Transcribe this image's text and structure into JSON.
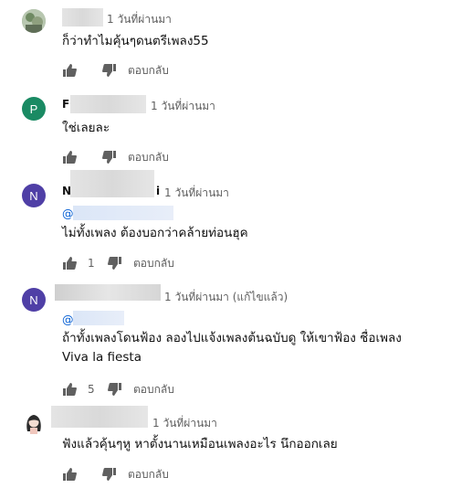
{
  "comments": [
    {
      "avatar_letter": "",
      "avatar_kind": "photo",
      "visible_name_fragment": "",
      "time": "1 วันที่ผ่านมา",
      "mention": "",
      "text_lines": [
        "ก็ว่าทำไมคุ้นๆดนตรีเพลง55"
      ],
      "likes": "",
      "reply_label": "ตอบกลับ"
    },
    {
      "avatar_letter": "P",
      "avatar_color": "#1a8a63",
      "visible_name_fragment": "F",
      "time": "1 วันที่ผ่านมา",
      "mention": "",
      "text_lines": [
        "ใช่เลยละ"
      ],
      "likes": "",
      "reply_label": "ตอบกลับ"
    },
    {
      "avatar_letter": "N",
      "avatar_color": "#4f3fa6",
      "visible_name_fragment": "N",
      "visible_name_tail": "i",
      "time": "1 วันที่ผ่านมา",
      "mention": "@",
      "text_lines": [
        "ไม่ทั้งเพลง ต้องบอกว่าคล้ายท่อนฮุค"
      ],
      "likes": "1",
      "reply_label": "ตอบกลับ"
    },
    {
      "avatar_letter": "N",
      "avatar_color": "#4f3fa6",
      "visible_name_fragment": "",
      "time": "1 วันที่ผ่านมา (แก้ไขแล้ว)",
      "mention": "@",
      "text_lines": [
        "ถ้าทั้งเพลงโดนฟ้อง   ลองไปแจ้งเพลงต้นฉบับดู ให้เขาฟ้อง ชื่อเพลง",
        "Viva la fiesta"
      ],
      "likes": "5",
      "reply_label": "ตอบกลับ"
    },
    {
      "avatar_letter": "",
      "avatar_kind": "drawing",
      "visible_name_fragment": "",
      "time": "1 วันที่ผ่านมา",
      "mention": "",
      "text_lines": [
        "ฟังแล้วคุ้นๆหู หาตั้งนานเหมือนเพลงอะไร นึกออกเลย"
      ],
      "likes": "",
      "reply_label": "ตอบกลับ"
    }
  ]
}
